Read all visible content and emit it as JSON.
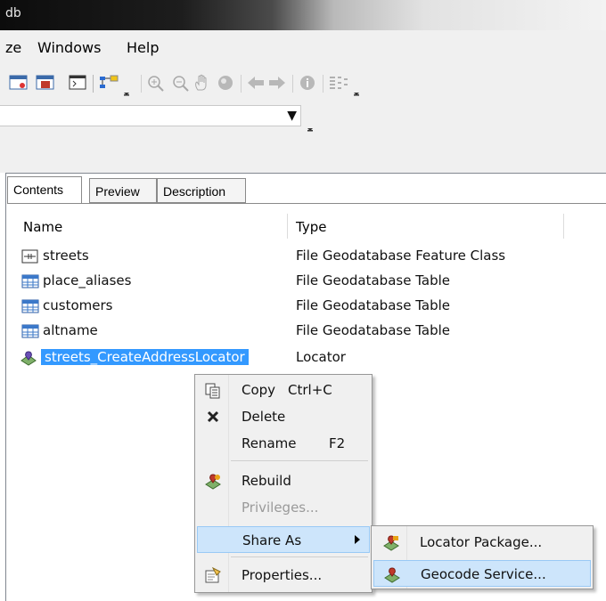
{
  "window": {
    "title": "db"
  },
  "menubar": {
    "items": [
      "ze",
      "Windows",
      "Help"
    ]
  },
  "toolbar": {
    "icons": [
      "window-icon",
      "catalog-window-icon",
      "arctoolbox-icon",
      "model-icon",
      "zoom-in-icon",
      "zoom-out-icon",
      "pan-icon",
      "full-extent-icon",
      "back-icon",
      "forward-icon",
      "identify-icon",
      "metadata-icon"
    ]
  },
  "location": {
    "value": ""
  },
  "tabs": [
    {
      "label": "Contents",
      "active": true
    },
    {
      "label": "Preview",
      "active": false
    },
    {
      "label": "Description",
      "active": false
    }
  ],
  "table": {
    "columns": [
      "Name",
      "Type"
    ],
    "rows": [
      {
        "name": "streets",
        "type": "File Geodatabase Feature Class",
        "icon": "line-feature-class-icon"
      },
      {
        "name": "place_aliases",
        "type": "File Geodatabase Table",
        "icon": "table-icon"
      },
      {
        "name": "customers",
        "type": "File Geodatabase Table",
        "icon": "table-icon"
      },
      {
        "name": "altname",
        "type": "File Geodatabase Table",
        "icon": "table-icon"
      },
      {
        "name": "streets_CreateAddressLocator",
        "type": "Locator",
        "icon": "locator-icon",
        "selected": true
      }
    ]
  },
  "context_menu": {
    "items": [
      {
        "label": "Copy",
        "shortcut": "Ctrl+C",
        "icon": "copy-icon"
      },
      {
        "label": "Delete",
        "shortcut": "",
        "icon": "delete-icon"
      },
      {
        "label": "Rename",
        "shortcut": "F2",
        "icon": ""
      },
      {
        "label": "Rebuild",
        "shortcut": "",
        "icon": "rebuild-icon"
      },
      {
        "label": "Privileges...",
        "shortcut": "",
        "icon": "",
        "disabled": true
      },
      {
        "label": "Share As",
        "shortcut": "",
        "icon": "",
        "submenu": true,
        "highlighted": true
      },
      {
        "label": "Properties...",
        "shortcut": "",
        "icon": "properties-icon"
      }
    ]
  },
  "submenu": {
    "items": [
      {
        "label": "Locator Package...",
        "icon": "locator-package-icon"
      },
      {
        "label": "Geocode Service...",
        "icon": "geocode-service-icon",
        "highlighted": true
      }
    ]
  }
}
